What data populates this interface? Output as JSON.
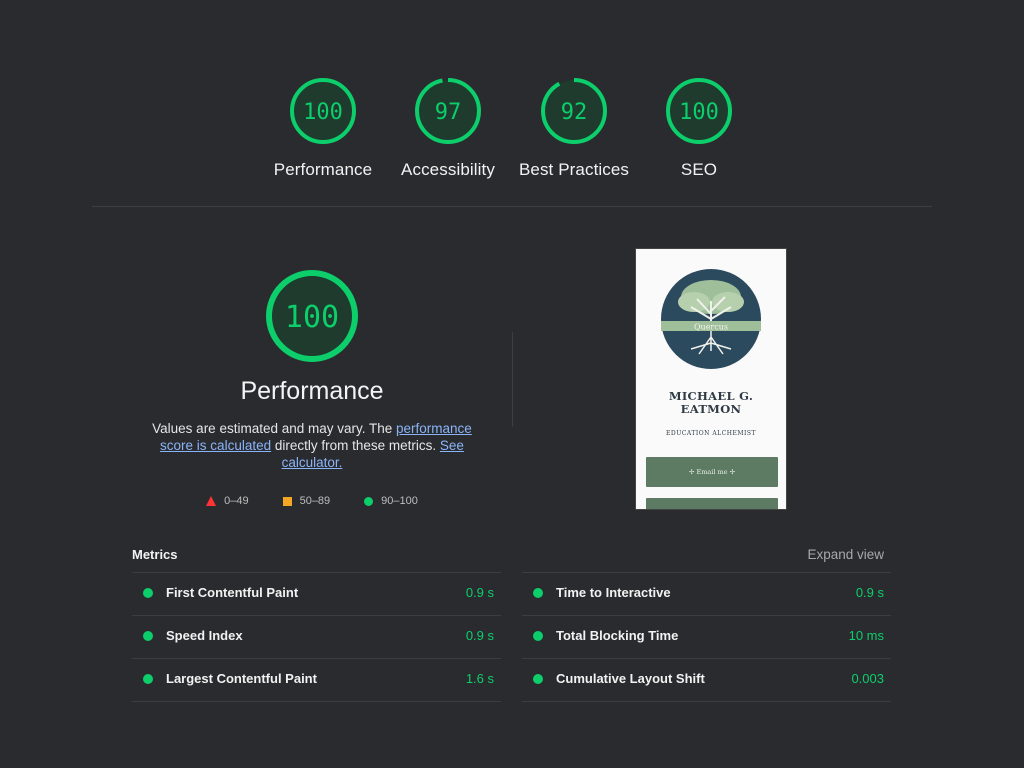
{
  "scores": [
    {
      "label": "Performance",
      "score": "100",
      "value": 100
    },
    {
      "label": "Accessibility",
      "score": "97",
      "value": 97
    },
    {
      "label": "Best Practices",
      "score": "92",
      "value": 92
    },
    {
      "label": "SEO",
      "score": "100",
      "value": 100
    }
  ],
  "performance": {
    "score": "100",
    "title": "Performance",
    "desc_prefix": "Values are estimated and may vary. The ",
    "desc_link1": "performance score is calculated",
    "desc_middle": " directly from these metrics. ",
    "desc_link2": "See calculator."
  },
  "legend": {
    "fail": "0–49",
    "average": "50–89",
    "pass": "90–100"
  },
  "preview": {
    "logo_text": "Quercus",
    "name_line1": "MICHAEL G.",
    "name_line2": "EATMON",
    "subtitle": "EDUCATION ALCHEMIST",
    "button1": "✢ Email me ✢",
    "button2": ""
  },
  "metrics": {
    "title": "Metrics",
    "expand": "Expand view",
    "left": [
      {
        "label": "First Contentful Paint",
        "value": "0.9 s"
      },
      {
        "label": "Speed Index",
        "value": "0.9 s"
      },
      {
        "label": "Largest Contentful Paint",
        "value": "1.6 s"
      }
    ],
    "right": [
      {
        "label": "Time to Interactive",
        "value": "0.9 s"
      },
      {
        "label": "Total Blocking Time",
        "value": "10 ms"
      },
      {
        "label": "Cumulative Layout Shift",
        "value": "0.003"
      }
    ]
  },
  "colors": {
    "pass": "#0cce6b",
    "pass_bg": "#1e3b2d",
    "background": "#2a2b2f",
    "link": "#8ab4f8"
  }
}
